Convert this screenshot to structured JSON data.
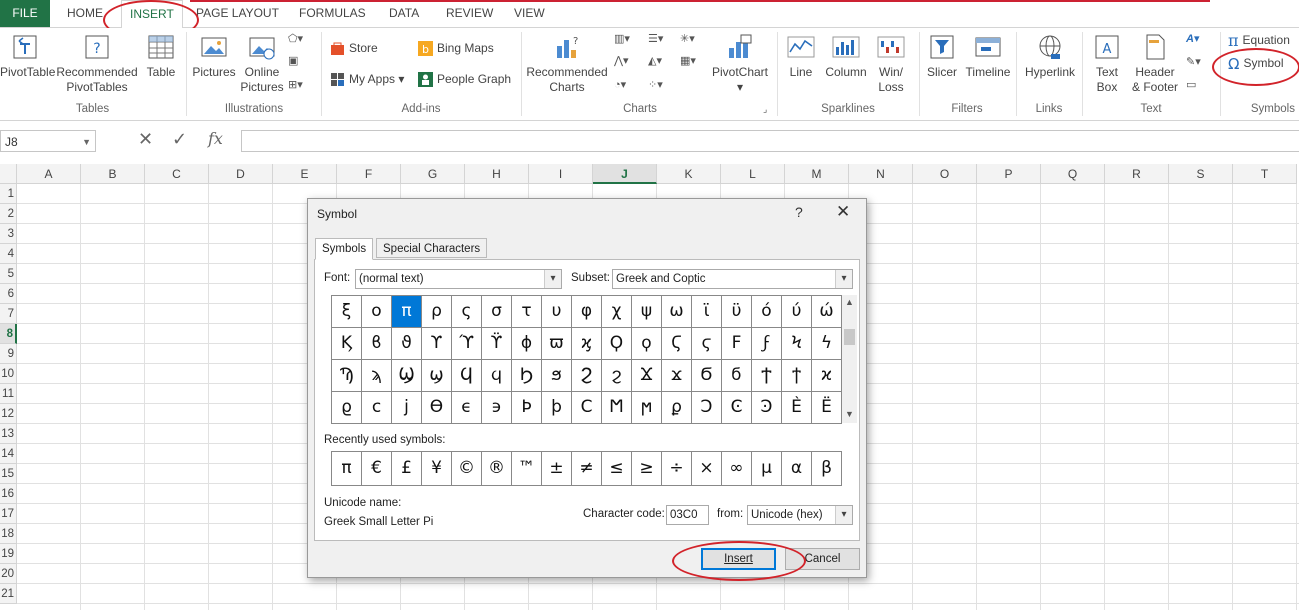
{
  "tabs": {
    "file": "FILE",
    "items": [
      "HOME",
      "INSERT",
      "PAGE LAYOUT",
      "FORMULAS",
      "DATA",
      "REVIEW",
      "VIEW"
    ],
    "active": "INSERT"
  },
  "ribbon": {
    "tables": {
      "group": "Tables",
      "pivottable": "PivotTable",
      "recommended_line1": "Recommended",
      "recommended_line2": "PivotTables",
      "table": "Table"
    },
    "illustrations": {
      "group": "Illustrations",
      "pictures": "Pictures",
      "online_line1": "Online",
      "online_line2": "Pictures"
    },
    "addins": {
      "group": "Add-ins",
      "store": "Store",
      "my_apps": "My Apps",
      "bing_maps": "Bing Maps",
      "people_graph": "People Graph"
    },
    "charts": {
      "group": "Charts",
      "recommended_line1": "Recommended",
      "recommended_line2": "Charts",
      "pivotchart": "PivotChart"
    },
    "sparklines": {
      "group": "Sparklines",
      "line": "Line",
      "column": "Column",
      "winloss_line1": "Win/",
      "winloss_line2": "Loss"
    },
    "filters": {
      "group": "Filters",
      "slicer": "Slicer",
      "timeline": "Timeline"
    },
    "links": {
      "group": "Links",
      "hyperlink": "Hyperlink"
    },
    "text": {
      "group": "Text",
      "textbox_line1": "Text",
      "textbox_line2": "Box",
      "header_line1": "Header",
      "header_line2": "& Footer"
    },
    "symbols": {
      "group": "Symbols",
      "equation": "Equation",
      "symbol": "Symbol"
    }
  },
  "formula_bar": {
    "name_box": "J8",
    "fx": "fx",
    "value": ""
  },
  "grid": {
    "columns": [
      "A",
      "B",
      "C",
      "D",
      "E",
      "F",
      "G",
      "H",
      "I",
      "J",
      "K",
      "L",
      "M",
      "N",
      "O",
      "P",
      "Q",
      "R",
      "S",
      "T"
    ],
    "rows": [
      "1",
      "2",
      "3",
      "4",
      "5",
      "6",
      "7",
      "8",
      "9",
      "10",
      "11",
      "12",
      "13",
      "14",
      "15",
      "16",
      "17",
      "18",
      "19",
      "20",
      "21"
    ],
    "selected_column": "J",
    "selected_row": "8"
  },
  "dialog": {
    "title": "Symbol",
    "help": "?",
    "close": "✕",
    "tab_symbols": "Symbols",
    "tab_special": "Special Characters",
    "font_label": "Font:",
    "font_value": "(normal text)",
    "subset_label": "Subset:",
    "subset_value": "Greek and Coptic",
    "symbols": [
      "ξ",
      "ο",
      "π",
      "ρ",
      "ς",
      "σ",
      "τ",
      "υ",
      "φ",
      "χ",
      "ψ",
      "ω",
      "ϊ",
      "ϋ",
      "ό",
      "ύ",
      "ώ",
      "Ϗ",
      "ϐ",
      "ϑ",
      "ϒ",
      "ϓ",
      "ϔ",
      "ϕ",
      "ϖ",
      "ϗ",
      "Ϙ",
      "ϙ",
      "Ϛ",
      "ϛ",
      "Ϝ",
      "ϝ",
      "Ϟ",
      "ϟ",
      "Ϡ",
      "ϡ",
      "Ϣ",
      "ϣ",
      "Ϥ",
      "ϥ",
      "Ϧ",
      "ϧ",
      "Ϩ",
      "ϩ",
      "Ϫ",
      "ϫ",
      "Ϭ",
      "ϭ",
      "Ϯ",
      "ϯ",
      "ϰ",
      "ϱ",
      "ϲ",
      "ϳ",
      "ϴ",
      "ϵ",
      "϶",
      "Ϸ",
      "ϸ",
      "Ϲ",
      "Ϻ",
      "ϻ",
      "ϼ",
      "Ͻ",
      "Ͼ",
      "Ͽ",
      "Ѐ",
      "Ё"
    ],
    "selected_symbol": "π",
    "recent_label": "Recently used symbols:",
    "recent": [
      "π",
      "€",
      "£",
      "¥",
      "©",
      "®",
      "™",
      "±",
      "≠",
      "≤",
      "≥",
      "÷",
      "×",
      "∞",
      "µ",
      "α",
      "β"
    ],
    "unicode_name_label": "Unicode name:",
    "unicode_name_value": "Greek Small Letter Pi",
    "char_code_label": "Character code:",
    "char_code_value": "03C0",
    "from_label": "from:",
    "from_value": "Unicode (hex)",
    "insert": "Insert",
    "cancel": "Cancel"
  },
  "colors": {
    "excel_green": "#217346",
    "annotation_red": "#d2232a",
    "selection_blue": "#0078d7"
  }
}
